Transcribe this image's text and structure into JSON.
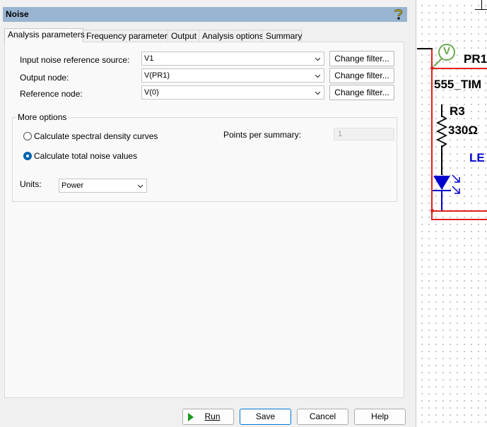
{
  "dialog": {
    "title": "Noise",
    "help_icon": "question-help-icon"
  },
  "tabs": [
    {
      "label": "Analysis parameters",
      "active": true
    },
    {
      "label": "Frequency parameters",
      "active": false
    },
    {
      "label": "Output",
      "active": false
    },
    {
      "label": "Analysis options",
      "active": false
    },
    {
      "label": "Summary",
      "active": false
    }
  ],
  "analysis": {
    "input_source_label": "Input noise reference source:",
    "input_source_value": "V1",
    "output_node_label": "Output node:",
    "output_node_value": "V(PR1)",
    "reference_node_label": "Reference node:",
    "reference_node_value": "V(0)",
    "change_filter_label": "Change filter..."
  },
  "more_options": {
    "title": "More options",
    "spectral_label": "Calculate spectral density curves",
    "spectral_checked": false,
    "total_label": "Calculate total noise values",
    "total_checked": true,
    "points_label": "Points per summary:",
    "points_value": "1",
    "units_label": "Units:",
    "units_value": "Power"
  },
  "footer": {
    "run_label": "Run",
    "save_label": "Save",
    "cancel_label": "Cancel",
    "help_label": "Help"
  },
  "schematic": {
    "probe_label": "V",
    "probe_name": "PR1",
    "timer_label": "555_TIM",
    "resistor_name": "R3",
    "resistor_value": "330Ω",
    "led_label": "LE",
    "wire_color": "#e0201c",
    "component_color": "#0000d0"
  }
}
